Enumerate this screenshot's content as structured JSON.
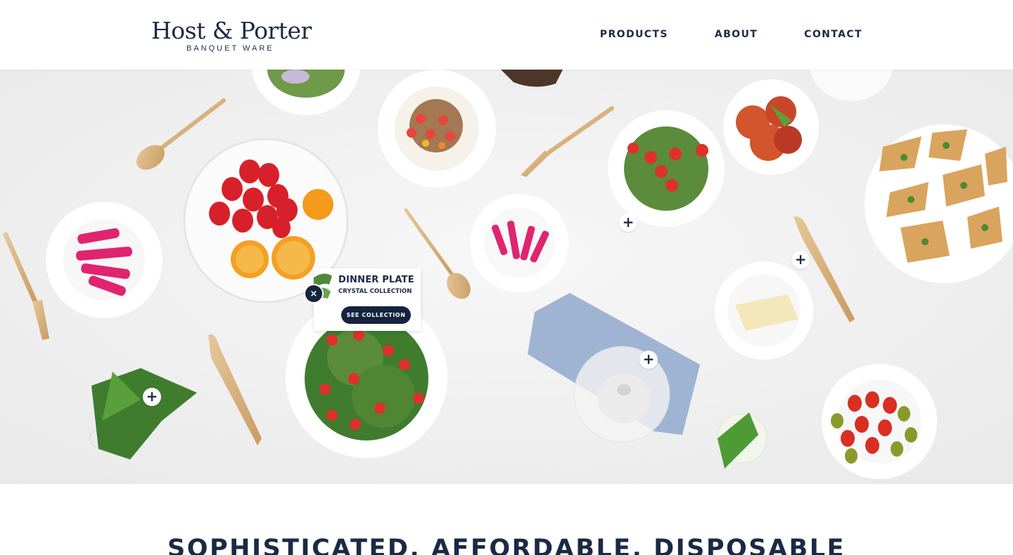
{
  "brand": {
    "name": "Host & Porter",
    "tagline": "BANQUET WARE"
  },
  "nav": {
    "items": [
      {
        "label": "PRODUCTS"
      },
      {
        "label": "ABOUT"
      },
      {
        "label": "CONTACT"
      }
    ]
  },
  "hero": {
    "hotspot_symbol": "+",
    "popup": {
      "title": "DINNER PLATE",
      "subtitle": "CRYSTAL COLLECTION",
      "button_label": "SEE COLLECTION",
      "close_symbol": "×"
    }
  },
  "intro": {
    "headline": "SOPHISTICATED. AFFORDABLE. DISPOSABLE"
  },
  "colors": {
    "navy": "#1b2a44",
    "button": "#15233f",
    "background": "#ffffff"
  }
}
